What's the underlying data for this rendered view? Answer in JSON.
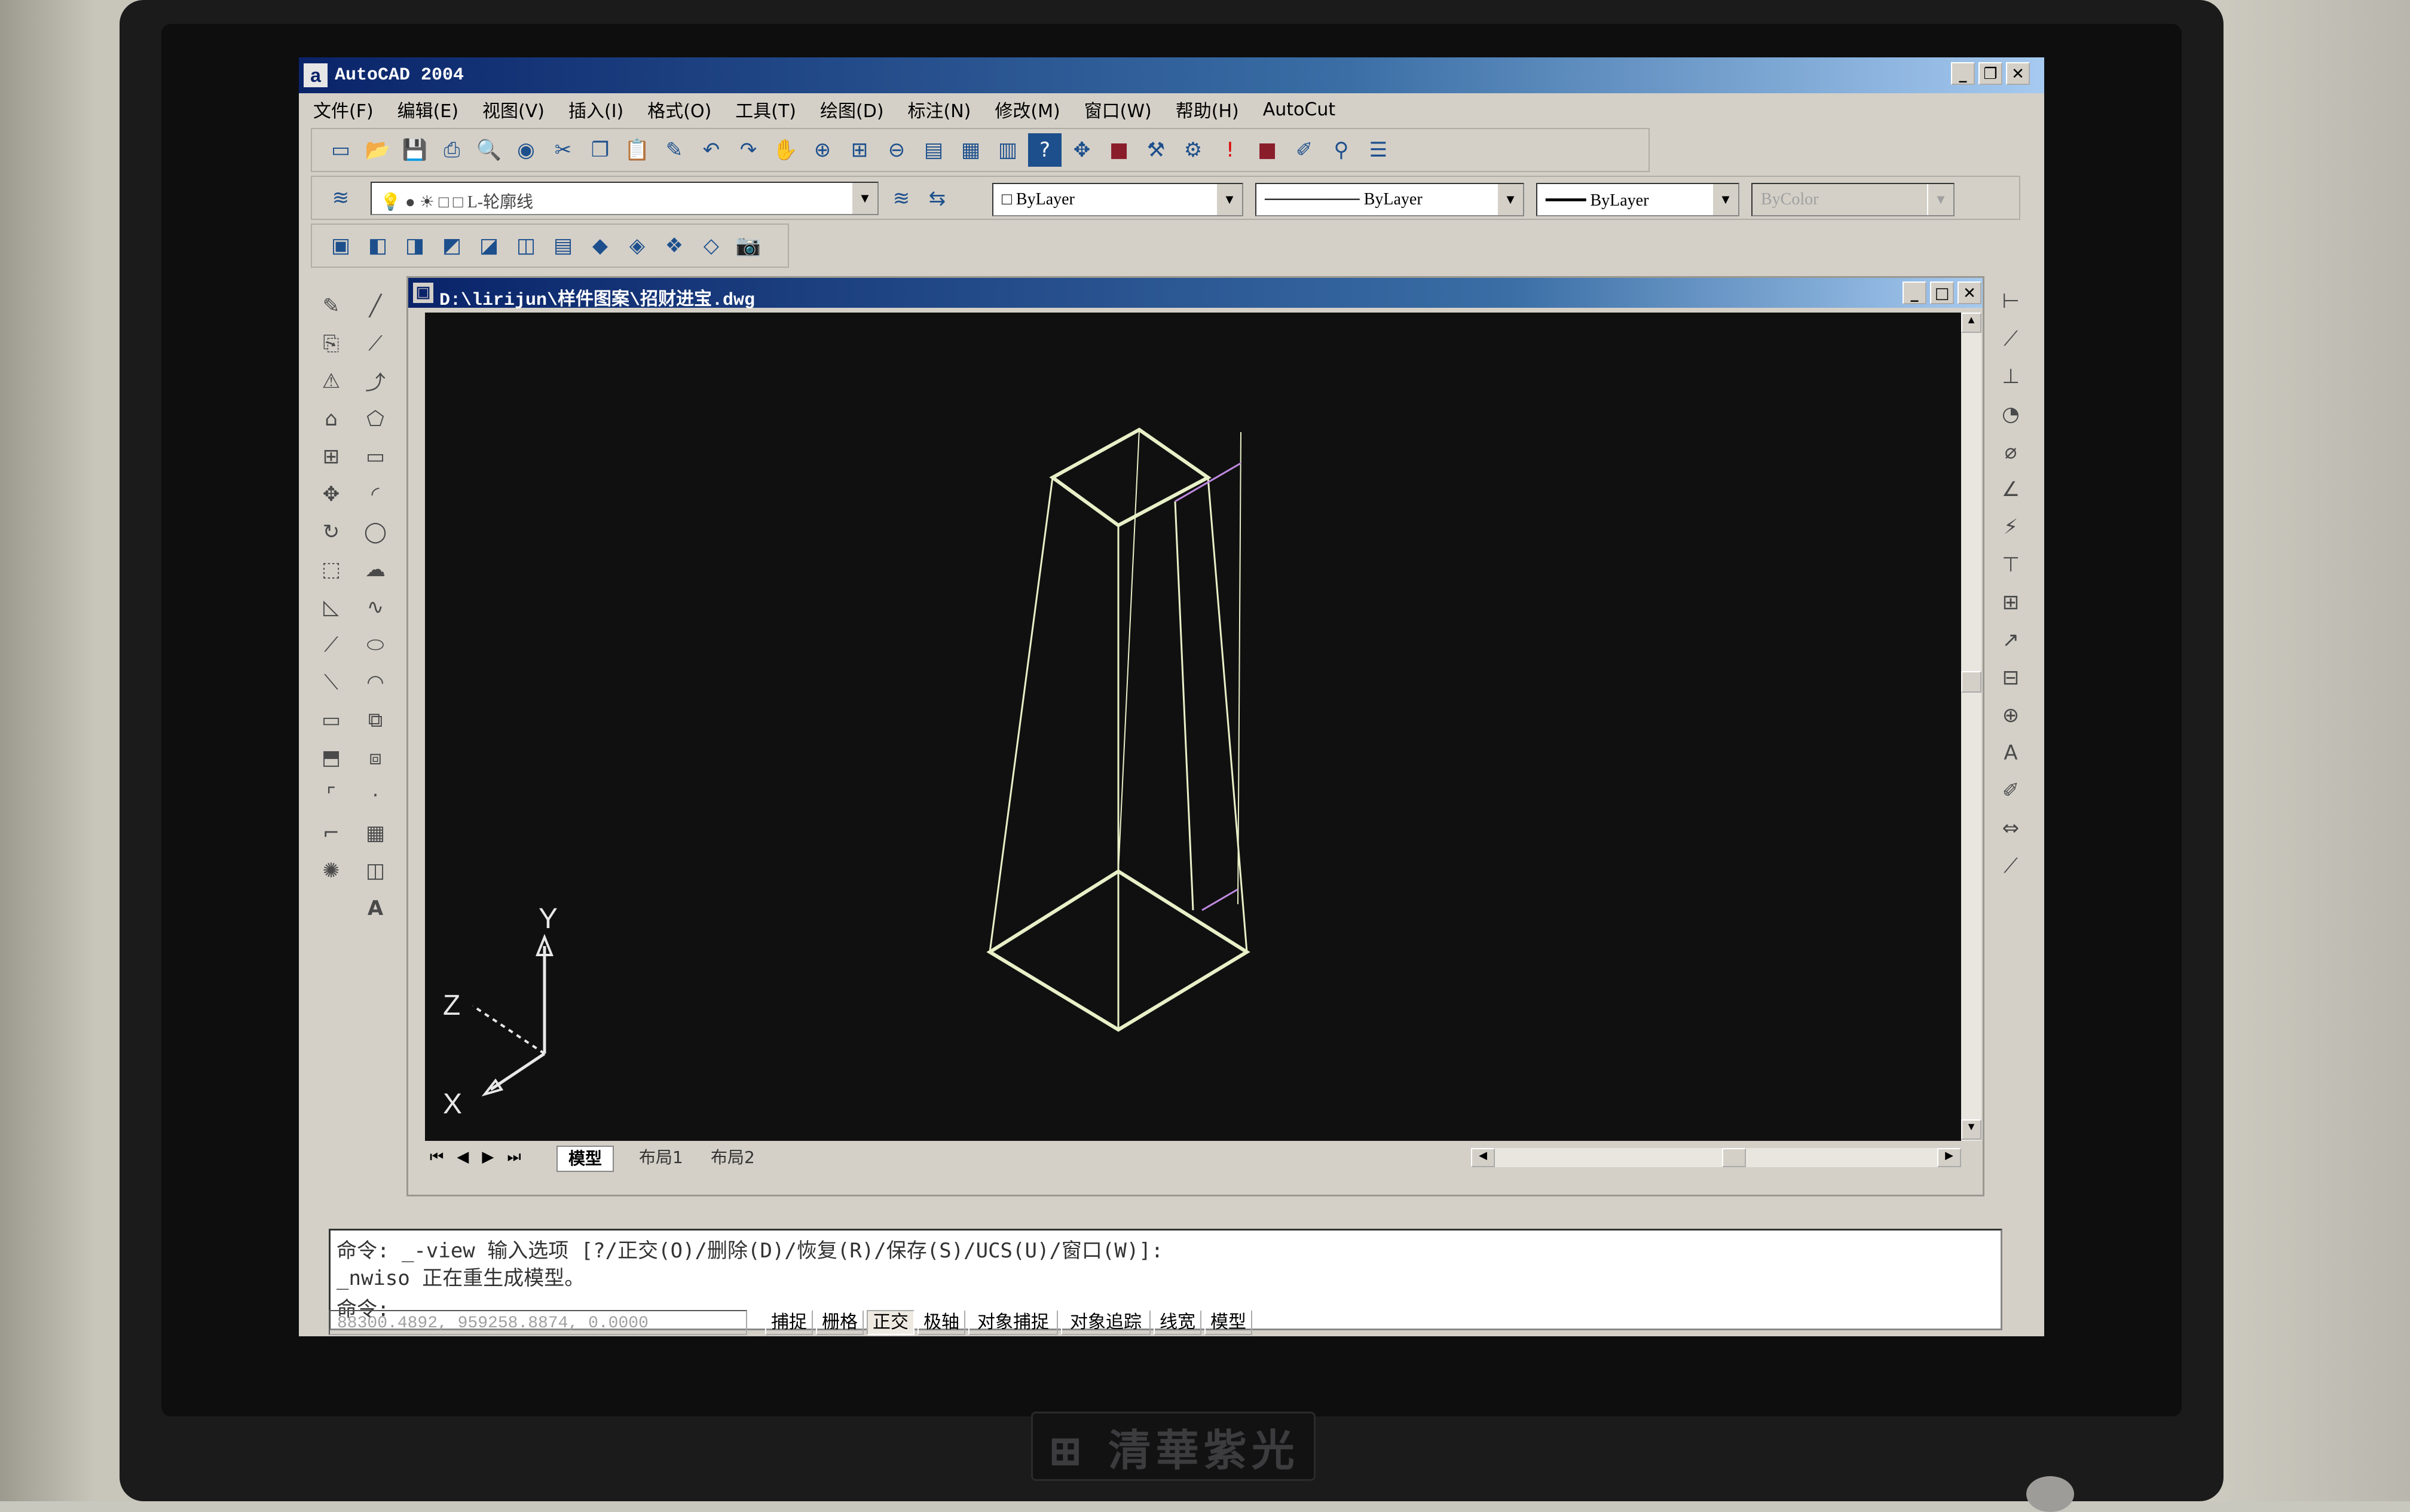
{
  "app": {
    "title": "AutoCAD 2004",
    "icon_glyph": "a",
    "window_buttons": [
      "_",
      "❐",
      "✕"
    ]
  },
  "menu": [
    "文件(F)",
    "编辑(E)",
    "视图(V)",
    "插入(I)",
    "格式(O)",
    "工具(T)",
    "绘图(D)",
    "标注(N)",
    "修改(M)",
    "窗口(W)",
    "帮助(H)",
    "AutoCut"
  ],
  "properties": {
    "layer": "L-轮廓线",
    "color": "ByLayer",
    "linetype": "ByLayer",
    "lineweight": "ByLayer",
    "plotstyle": "ByColor"
  },
  "document": {
    "title": "D:\\lirijun\\样件图案\\招财进宝.dwg",
    "buttons": [
      "_",
      "□",
      "✕"
    ]
  },
  "ucs_labels": {
    "y": "Y",
    "z": "Z",
    "x": "X"
  },
  "layout_tabs": [
    "模型",
    "布局1",
    "布局2"
  ],
  "command_lines": [
    "命令: _-view 输入选项 [?/正交(O)/删除(D)/恢复(R)/保存(S)/UCS(U)/窗口(W)]:",
    "_nwiso 正在重生成模型。",
    "命令:"
  ],
  "status": {
    "coords": "88300.4892, 959258.8874, 0.0000",
    "toggles": [
      "捕捉",
      "栅格",
      "正交",
      "极轴",
      "对象捕捉",
      "对象追踪",
      "线宽",
      "模型"
    ]
  },
  "colors": {
    "wire": "#e8f0c8",
    "magenta": "#c08ae0",
    "canvas": "#101010"
  },
  "icons": [
    "new-icon",
    "open-icon",
    "save-icon",
    "print-icon",
    "preview-icon",
    "publish-icon",
    "cut-icon",
    "copy-icon",
    "paste-icon",
    "matchprop-icon",
    "undo-icon",
    "redo-icon",
    "pan-icon",
    "zoom-realtime-icon",
    "zoom-window-icon",
    "zoom-previous-icon",
    "properties-icon",
    "designcenter-icon",
    "toolpalette-icon",
    "help-icon"
  ]
}
